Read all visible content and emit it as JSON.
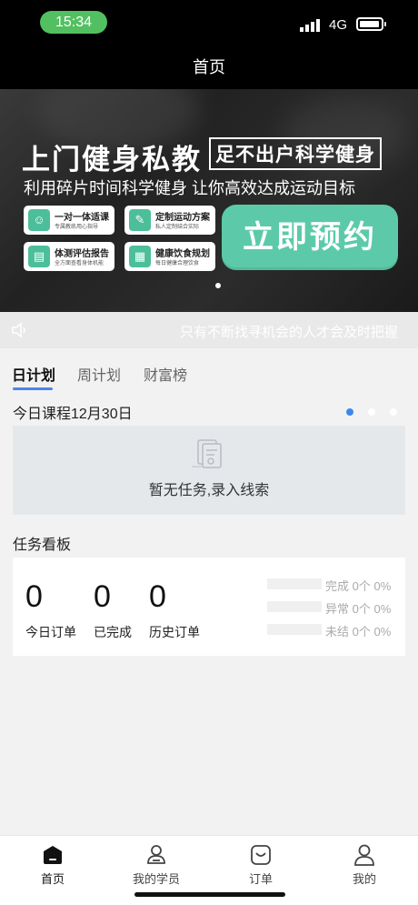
{
  "status_bar": {
    "time": "15:34",
    "network": "4G"
  },
  "nav": {
    "title": "首页"
  },
  "banner": {
    "title": "上门健身私教",
    "tag": "足不出户科学健身",
    "subtitle": "利用碎片时间科学健身 让你高效达成运动目标",
    "features": [
      {
        "title": "一对一体适课",
        "desc": "专属教练用心指导",
        "icon": "person-icon"
      },
      {
        "title": "定制运动方案",
        "desc": "私人定制结合实际",
        "icon": "dumbbell-icon"
      },
      {
        "title": "体测评估报告",
        "desc": "全方面查看身体机能",
        "icon": "report-icon"
      },
      {
        "title": "健康饮食规划",
        "desc": "每日健康合理饮食",
        "icon": "calendar-icon"
      }
    ],
    "cta": "立即预约"
  },
  "notice": {
    "text": "只有不断找寻机会的人才会及时把握"
  },
  "tabs": [
    {
      "label": "日计划",
      "active": true
    },
    {
      "label": "周计划",
      "active": false
    },
    {
      "label": "财富榜",
      "active": false
    }
  ],
  "course": {
    "title": "今日课程12月30日",
    "empty_text": "暂无任务,录入线索",
    "page_dots": 3,
    "active_dot": 0
  },
  "board": {
    "title": "任务看板",
    "stats": [
      {
        "value": "0",
        "label": "今日订单"
      },
      {
        "value": "0",
        "label": "已完成"
      },
      {
        "value": "0",
        "label": "历史订单"
      }
    ],
    "bars": [
      {
        "label": "完成",
        "count": "0个",
        "percent": "0%"
      },
      {
        "label": "异常",
        "count": "0个",
        "percent": "0%"
      },
      {
        "label": "未结",
        "count": "0个",
        "percent": "0%"
      }
    ]
  },
  "bottom_nav": [
    {
      "label": "首页",
      "icon": "home-icon",
      "active": true
    },
    {
      "label": "我的学员",
      "icon": "students-icon",
      "active": false
    },
    {
      "label": "订单",
      "icon": "order-icon",
      "active": false
    },
    {
      "label": "我的",
      "icon": "profile-icon",
      "active": false
    }
  ],
  "colors": {
    "accent": "#4a86e8",
    "cta": "#5ccaa8",
    "status_pill": "#52c060"
  }
}
